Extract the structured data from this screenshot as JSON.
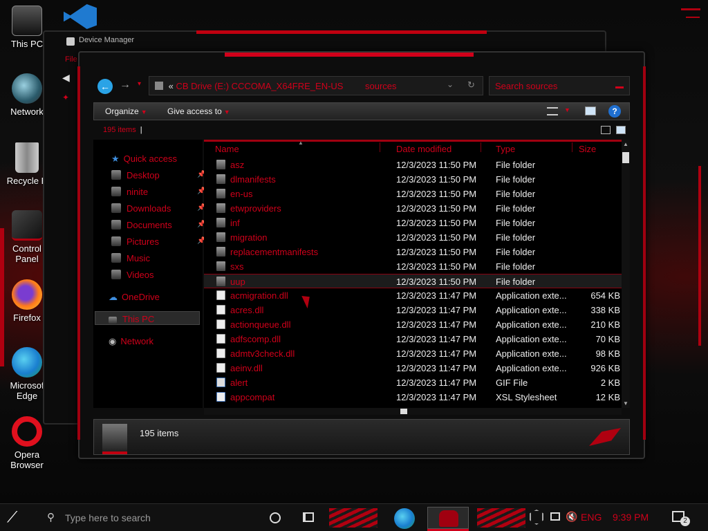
{
  "desktop": {
    "icons": [
      {
        "label": "This PC",
        "icon": "this-pc-icon"
      },
      {
        "label": "Network",
        "icon": "network-globe-icon"
      },
      {
        "label": "Recycle B",
        "icon": "recycle-bin-icon"
      },
      {
        "label": "Control Panel",
        "icon": "control-panel-icon"
      },
      {
        "label": "Firefox",
        "icon": "firefox-icon"
      },
      {
        "label": "Microsof Edge",
        "icon": "edge-icon"
      },
      {
        "label": "Opera Browser",
        "icon": "opera-icon"
      }
    ]
  },
  "back_window": {
    "title": "Device Manager",
    "menu_fragment": "File"
  },
  "explorer": {
    "address": {
      "prefix": "«",
      "drive": "CB Drive (E:) CCCOMA_X64FRE_EN-US",
      "current": "sources"
    },
    "search_placeholder": "Search sources",
    "toolbar": {
      "organize": "Organize",
      "give_access": "Give access to"
    },
    "item_count_top": "195 items",
    "nav": {
      "quick_access": "Quick access",
      "items": [
        "Desktop",
        "ninite",
        "Downloads",
        "Documents",
        "Pictures",
        "Music",
        "Videos"
      ],
      "onedrive": "OneDrive",
      "this_pc": "This PC",
      "network": "Network"
    },
    "columns": {
      "name": "Name",
      "date": "Date modified",
      "type": "Type",
      "size": "Size"
    },
    "files": [
      {
        "name": "asz",
        "date": "12/3/2023 11:50 PM",
        "type": "File folder",
        "size": "",
        "kind": "folder"
      },
      {
        "name": "dlmanifests",
        "date": "12/3/2023 11:50 PM",
        "type": "File folder",
        "size": "",
        "kind": "folder"
      },
      {
        "name": "en-us",
        "date": "12/3/2023 11:50 PM",
        "type": "File folder",
        "size": "",
        "kind": "folder"
      },
      {
        "name": "etwproviders",
        "date": "12/3/2023 11:50 PM",
        "type": "File folder",
        "size": "",
        "kind": "folder"
      },
      {
        "name": "inf",
        "date": "12/3/2023 11:50 PM",
        "type": "File folder",
        "size": "",
        "kind": "folder"
      },
      {
        "name": "migration",
        "date": "12/3/2023 11:50 PM",
        "type": "File folder",
        "size": "",
        "kind": "folder"
      },
      {
        "name": "replacementmanifests",
        "date": "12/3/2023 11:50 PM",
        "type": "File folder",
        "size": "",
        "kind": "folder"
      },
      {
        "name": "sxs",
        "date": "12/3/2023 11:50 PM",
        "type": "File folder",
        "size": "",
        "kind": "folder"
      },
      {
        "name": "uup",
        "date": "12/3/2023 11:50 PM",
        "type": "File folder",
        "size": "",
        "kind": "folder",
        "selected": true
      },
      {
        "name": "acmigration.dll",
        "date": "12/3/2023 11:47 PM",
        "type": "Application exte...",
        "size": "654 KB",
        "kind": "dll"
      },
      {
        "name": "acres.dll",
        "date": "12/3/2023 11:47 PM",
        "type": "Application exte...",
        "size": "338 KB",
        "kind": "dll"
      },
      {
        "name": "actionqueue.dll",
        "date": "12/3/2023 11:47 PM",
        "type": "Application exte...",
        "size": "210 KB",
        "kind": "dll"
      },
      {
        "name": "adfscomp.dll",
        "date": "12/3/2023 11:47 PM",
        "type": "Application exte...",
        "size": "70 KB",
        "kind": "dll"
      },
      {
        "name": "admtv3check.dll",
        "date": "12/3/2023 11:47 PM",
        "type": "Application exte...",
        "size": "98 KB",
        "kind": "dll"
      },
      {
        "name": "aeinv.dll",
        "date": "12/3/2023 11:47 PM",
        "type": "Application exte...",
        "size": "926 KB",
        "kind": "dll"
      },
      {
        "name": "alert",
        "date": "12/3/2023 11:47 PM",
        "type": "GIF File",
        "size": "2 KB",
        "kind": "gif"
      },
      {
        "name": "appcompat",
        "date": "12/3/2023 11:47 PM",
        "type": "XSL Stylesheet",
        "size": "12 KB",
        "kind": "xsl"
      }
    ],
    "details_text": "195 items"
  },
  "taskbar": {
    "search_placeholder": "Type here to search",
    "language": "ENG",
    "time": "9:39 PM",
    "notification_count": "2"
  },
  "colors": {
    "accent_red": "#d0001a",
    "background": "#050505"
  }
}
